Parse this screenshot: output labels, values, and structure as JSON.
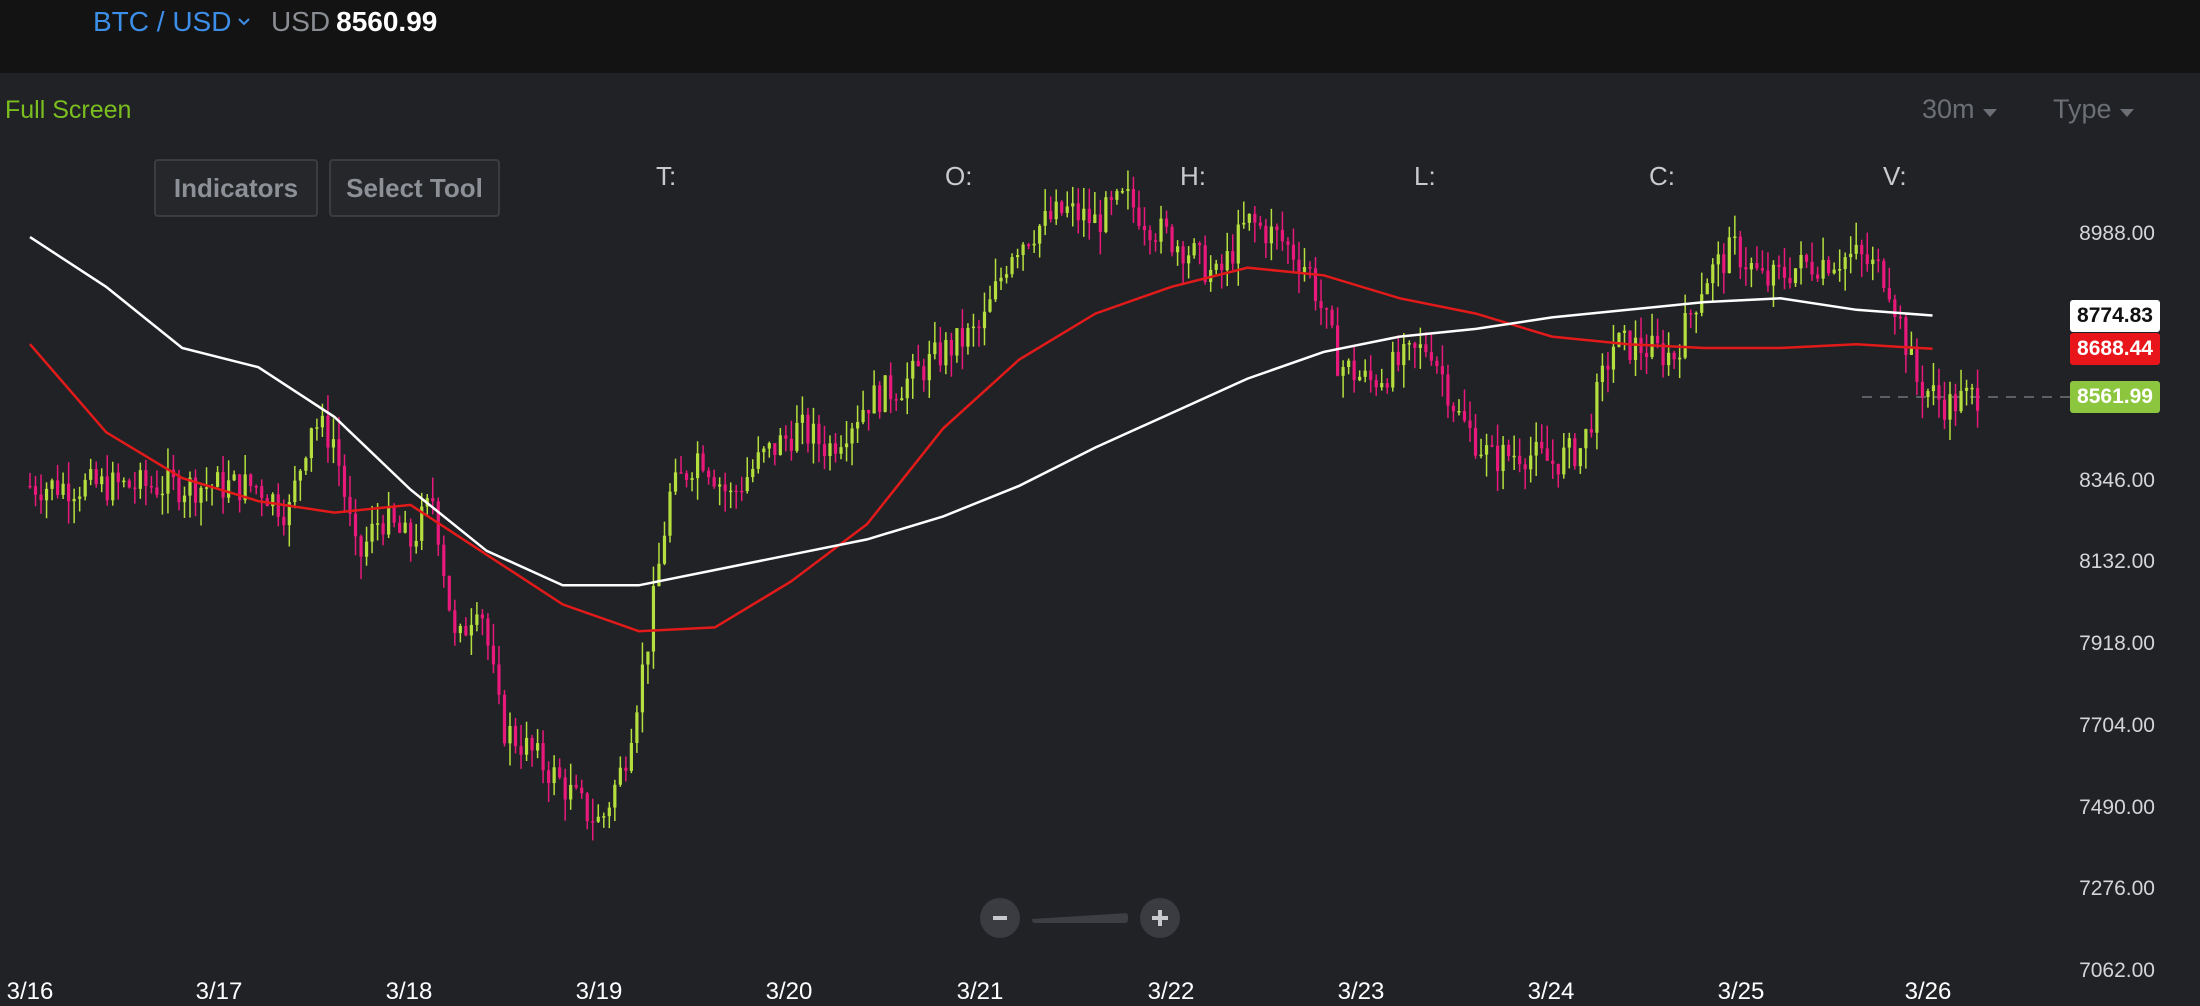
{
  "header": {
    "pair_label": "BTC / USD",
    "currency_label": "USD",
    "price": "8560.99"
  },
  "toolbar": {
    "fullscreen_label": "Full Screen",
    "interval_label": "30m",
    "type_label": "Type",
    "indicators_label": "Indicators",
    "select_tool_label": "Select Tool"
  },
  "ohlc": {
    "time_label": "T:",
    "open_label": "O:",
    "high_label": "H:",
    "low_label": "L:",
    "close_label": "C:",
    "volume_label": "V:"
  },
  "colors": {
    "up": "#b5df3e",
    "down": "#e8197a",
    "ma_white": "#ffffff",
    "ma_red": "#e21a1a",
    "accent_blue": "#3d8ee8",
    "accent_green": "#7bbf1f"
  },
  "chart_data": {
    "type": "line",
    "y_axis_ticks": [
      "8988.00",
      "8346.00",
      "8132.00",
      "7918.00",
      "7704.00",
      "7490.00",
      "7276.00",
      "7062.00"
    ],
    "x_axis_ticks": [
      "3/16",
      "3/17",
      "3/18",
      "3/19",
      "3/20",
      "3/21",
      "3/22",
      "3/23",
      "3/24",
      "3/25",
      "3/26"
    ],
    "ylim": [
      7062,
      9200
    ],
    "last_price_label": "8561.99",
    "ma_white_label": "8774.83",
    "ma_red_label": "8688.44",
    "price_path": [
      [
        3.0,
        8330
      ],
      [
        3.4,
        8260
      ],
      [
        3.7,
        8500
      ],
      [
        4.0,
        8450
      ],
      [
        4.3,
        8130
      ],
      [
        4.6,
        8250
      ],
      [
        5.0,
        8180
      ],
      [
        5.3,
        8300
      ],
      [
        5.6,
        7900
      ],
      [
        5.9,
        8050
      ],
      [
        6.2,
        7700
      ],
      [
        6.5,
        7650
      ],
      [
        7.0,
        7550
      ],
      [
        7.3,
        7480
      ],
      [
        7.5,
        7450
      ],
      [
        7.8,
        7600
      ],
      [
        8.1,
        7900
      ],
      [
        8.4,
        8300
      ],
      [
        8.8,
        8420
      ],
      [
        9.2,
        8300
      ],
      [
        9.6,
        8400
      ],
      [
        10.1,
        8480
      ],
      [
        10.5,
        8430
      ],
      [
        11.0,
        8550
      ],
      [
        11.5,
        8600
      ],
      [
        12.0,
        8680
      ],
      [
        12.5,
        8740
      ],
      [
        12.9,
        8950
      ],
      [
        13.2,
        9000
      ],
      [
        13.6,
        9050
      ],
      [
        14.0,
        9020
      ],
      [
        14.4,
        9080
      ],
      [
        14.8,
        9000
      ],
      [
        15.2,
        8950
      ],
      [
        15.6,
        8870
      ],
      [
        16.0,
        9020
      ],
      [
        16.4,
        8980
      ],
      [
        16.8,
        8900
      ],
      [
        17.2,
        8650
      ],
      [
        17.6,
        8600
      ],
      [
        18.0,
        8650
      ],
      [
        18.4,
        8700
      ],
      [
        18.8,
        8500
      ],
      [
        19.2,
        8400
      ],
      [
        19.6,
        8420
      ],
      [
        20.0,
        8390
      ],
      [
        20.4,
        8430
      ],
      [
        20.8,
        8700
      ],
      [
        21.2,
        8690
      ],
      [
        21.6,
        8670
      ],
      [
        22.0,
        8870
      ],
      [
        22.4,
        8950
      ],
      [
        22.8,
        8860
      ],
      [
        23.2,
        8900
      ],
      [
        23.6,
        8920
      ],
      [
        24.0,
        8930
      ],
      [
        24.4,
        8880
      ],
      [
        24.8,
        8600
      ],
      [
        25.2,
        8540
      ],
      [
        25.6,
        8570
      ]
    ],
    "ma_white": [
      [
        0,
        8980
      ],
      [
        1,
        8850
      ],
      [
        2,
        8690
      ],
      [
        3,
        8640
      ],
      [
        4,
        8510
      ],
      [
        5,
        8320
      ],
      [
        6,
        8160
      ],
      [
        7,
        8070
      ],
      [
        8,
        8070
      ],
      [
        9,
        8110
      ],
      [
        10,
        8150
      ],
      [
        11,
        8190
      ],
      [
        12,
        8250
      ],
      [
        13,
        8330
      ],
      [
        14,
        8430
      ],
      [
        15,
        8520
      ],
      [
        16,
        8610
      ],
      [
        17,
        8680
      ],
      [
        18,
        8720
      ],
      [
        19,
        8740
      ],
      [
        20,
        8770
      ],
      [
        21,
        8790
      ],
      [
        22,
        8810
      ],
      [
        23,
        8820
      ],
      [
        24,
        8790
      ],
      [
        25,
        8775
      ]
    ],
    "ma_red": [
      [
        0,
        8700
      ],
      [
        1,
        8470
      ],
      [
        2,
        8350
      ],
      [
        3,
        8290
      ],
      [
        4,
        8260
      ],
      [
        5,
        8280
      ],
      [
        6,
        8150
      ],
      [
        7,
        8020
      ],
      [
        8,
        7950
      ],
      [
        9,
        7960
      ],
      [
        10,
        8080
      ],
      [
        11,
        8230
      ],
      [
        12,
        8480
      ],
      [
        13,
        8660
      ],
      [
        14,
        8780
      ],
      [
        15,
        8850
      ],
      [
        16,
        8900
      ],
      [
        17,
        8880
      ],
      [
        18,
        8820
      ],
      [
        19,
        8780
      ],
      [
        20,
        8720
      ],
      [
        21,
        8700
      ],
      [
        22,
        8690
      ],
      [
        23,
        8690
      ],
      [
        24,
        8700
      ],
      [
        25,
        8688
      ]
    ]
  }
}
